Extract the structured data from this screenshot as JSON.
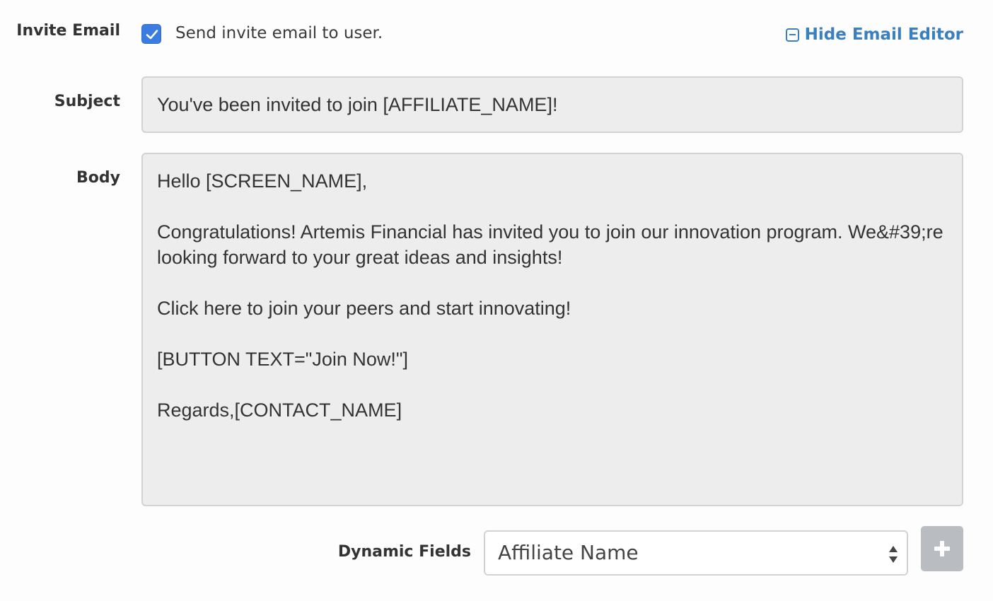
{
  "invite_email": {
    "label": "Invite Email",
    "checkbox_checked": true,
    "checkbox_text": "Send invite email to user.",
    "hide_editor_label": "Hide Email Editor",
    "accent_color": "#3b7ce0",
    "link_color": "#3b7fbf"
  },
  "subject": {
    "label": "Subject",
    "value": "You've been invited to join [AFFILIATE_NAME]!"
  },
  "body": {
    "label": "Body",
    "value": "Hello [SCREEN_NAME],\n\nCongratulations! Artemis Financial has invited you to join our innovation program. We&#39;re looking forward to your great ideas and insights!\n\nClick here to join your peers and start innovating!\n\n[BUTTON TEXT=\"Join Now!\"]\n\nRegards,[CONTACT_NAME]"
  },
  "dynamic_fields": {
    "label": "Dynamic Fields",
    "selected": "Affiliate Name",
    "add_icon": "plus-icon"
  }
}
